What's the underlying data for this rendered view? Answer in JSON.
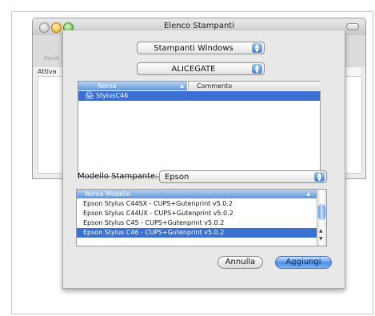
{
  "window": {
    "title": "Elenco Stampanti",
    "bg_toolbar_label": "Rendi",
    "bg_column": "Attiva"
  },
  "sheet": {
    "connection_popup": "Stampanti Windows",
    "workgroup_popup": "ALICEGATE",
    "printers_table": {
      "columns": [
        "Nome",
        "Commento"
      ],
      "rows": [
        {
          "name": "StylusC46",
          "comment": "",
          "selected": true
        }
      ]
    },
    "model_label": "Modello Stampante:",
    "model_popup": "Epson",
    "models_table": {
      "column": "Nome Modello",
      "rows": [
        {
          "name": "Epson Stylus C44SX - CUPS+Gutenprint v5.0.2",
          "selected": false
        },
        {
          "name": "Epson Stylus C44UX - CUPS+Gutenprint v5.0.2",
          "selected": false
        },
        {
          "name": "Epson Stylus C45 - CUPS+Gutenprint v5.0.2",
          "selected": false
        },
        {
          "name": "Epson Stylus C46 - CUPS+Gutenprint v5.0.2",
          "selected": true
        }
      ]
    },
    "cancel_label": "Annulla",
    "add_label": "Aggiungi"
  },
  "colors": {
    "selection": "#3b6fd1",
    "default_button": "#4f90e5"
  }
}
